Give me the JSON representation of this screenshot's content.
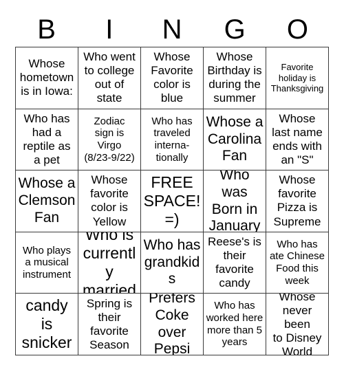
{
  "card": {
    "title": "BINGO Card",
    "header_letters": [
      "B",
      "I",
      "N",
      "G",
      "O"
    ],
    "grid_size": "5x5",
    "free_space_index": 12,
    "colors": {
      "background": "#ffffff",
      "text": "#000000",
      "border": "#3a3a3a"
    },
    "cells": [
      {
        "text": "Whose\nhometown\nis in Iowa:",
        "size": "md",
        "column": "B",
        "row": 1
      },
      {
        "text": "Who went\nto college\nout of\nstate",
        "size": "md",
        "column": "I",
        "row": 1
      },
      {
        "text": "Whose\nFavorite\ncolor is\nblue",
        "size": "md",
        "column": "N",
        "row": 1
      },
      {
        "text": "Whose\nBirthday is\nduring the\nsummer",
        "size": "md",
        "column": "G",
        "row": 1
      },
      {
        "text": "Favorite\nholiday is\nThanksgiving",
        "size": "xs",
        "column": "O",
        "row": 1
      },
      {
        "text": "Who has\nhad a\nreptile as\na pet",
        "size": "md",
        "column": "B",
        "row": 2
      },
      {
        "text": "Zodiac\nsign is\nVirgo\n(8/23-9/22)",
        "size": "sm",
        "column": "I",
        "row": 2
      },
      {
        "text": "Who has\ntraveled\ninterna-\ntionally",
        "size": "sm",
        "column": "N",
        "row": 2
      },
      {
        "text": "Whose a\nCarolina\nFan",
        "size": "lg",
        "column": "G",
        "row": 2
      },
      {
        "text": "Whose\nlast name\nends with\nan \"S\"",
        "size": "md",
        "column": "O",
        "row": 2
      },
      {
        "text": "Whose a\nClemson\nFan",
        "size": "lg",
        "column": "B",
        "row": 3
      },
      {
        "text": "Whose\nfavorite\ncolor is\nYellow",
        "size": "md",
        "column": "I",
        "row": 3
      },
      {
        "text": "FREE\nSPACE!\n=)",
        "size": "xl",
        "column": "N",
        "row": 3
      },
      {
        "text": "Who was\nBorn in\nJanuary",
        "size": "lg",
        "column": "G",
        "row": 3
      },
      {
        "text": "Whose\nfavorite\nPizza is\nSupreme",
        "size": "md",
        "column": "O",
        "row": 3
      },
      {
        "text": "Who plays\na musical\ninstrument",
        "size": "sm",
        "column": "B",
        "row": 4
      },
      {
        "text": "Who is\ncurrently\nmarried",
        "size": "xl",
        "column": "I",
        "row": 4
      },
      {
        "text": "Who has\ngrandkids",
        "size": "lg",
        "column": "N",
        "row": 4
      },
      {
        "text": "Reese's is\ntheir\nfavorite\ncandy",
        "size": "md",
        "column": "G",
        "row": 4
      },
      {
        "text": "Who has\nate Chinese\nFood this\nweek",
        "size": "sm",
        "column": "O",
        "row": 4
      },
      {
        "text": "Favorite\ncandy is\nsnickers",
        "size": "xl",
        "column": "B",
        "row": 5
      },
      {
        "text": "Spring is\ntheir\nfavorite\nSeason",
        "size": "md",
        "column": "I",
        "row": 5
      },
      {
        "text": "Prefers\nCoke over\nPepsi",
        "size": "lg",
        "column": "N",
        "row": 5
      },
      {
        "text": "Who has\nworked here\nmore than 5\nyears",
        "size": "sm",
        "column": "G",
        "row": 5
      },
      {
        "text": "Whose\nnever been\nto Disney\nWorld",
        "size": "md",
        "column": "O",
        "row": 5
      }
    ]
  }
}
